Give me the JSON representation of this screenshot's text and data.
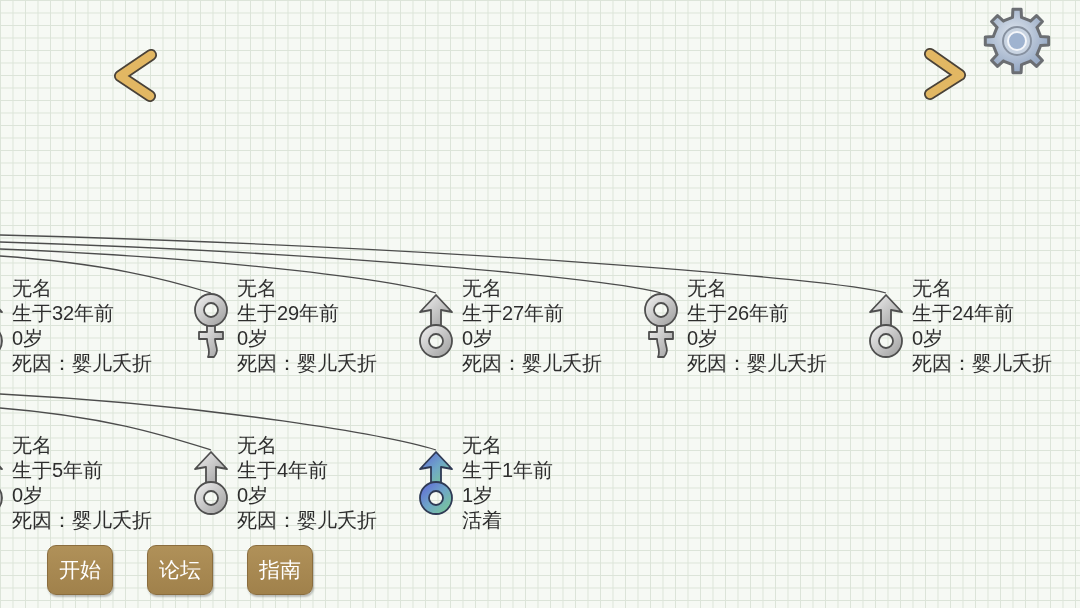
{
  "generations": [
    {
      "members": [
        {
          "kind": "male",
          "alive": false,
          "name": "无名",
          "born": "生于32年前",
          "age": "0岁",
          "fate": "死因：婴儿夭折"
        },
        {
          "kind": "female",
          "alive": false,
          "name": "无名",
          "born": "生于29年前",
          "age": "0岁",
          "fate": "死因：婴儿夭折"
        },
        {
          "kind": "male",
          "alive": false,
          "name": "无名",
          "born": "生于27年前",
          "age": "0岁",
          "fate": "死因：婴儿夭折"
        },
        {
          "kind": "female",
          "alive": false,
          "name": "无名",
          "born": "生于26年前",
          "age": "0岁",
          "fate": "死因：婴儿夭折"
        },
        {
          "kind": "male",
          "alive": false,
          "name": "无名",
          "born": "生于24年前",
          "age": "0岁",
          "fate": "死因：婴儿夭折"
        }
      ]
    },
    {
      "members": [
        {
          "kind": "male",
          "alive": false,
          "name": "无名",
          "born": "生于5年前",
          "age": "0岁",
          "fate": "死因：婴儿夭折"
        },
        {
          "kind": "male",
          "alive": false,
          "name": "无名",
          "born": "生于4年前",
          "age": "0岁",
          "fate": "死因：婴儿夭折"
        },
        {
          "kind": "male",
          "alive": true,
          "name": "无名",
          "born": "生于1年前",
          "age": "1岁",
          "fate": "活着"
        }
      ]
    }
  ],
  "buttons": [
    {
      "label": "开始"
    },
    {
      "label": "论坛"
    },
    {
      "label": "指南"
    }
  ]
}
